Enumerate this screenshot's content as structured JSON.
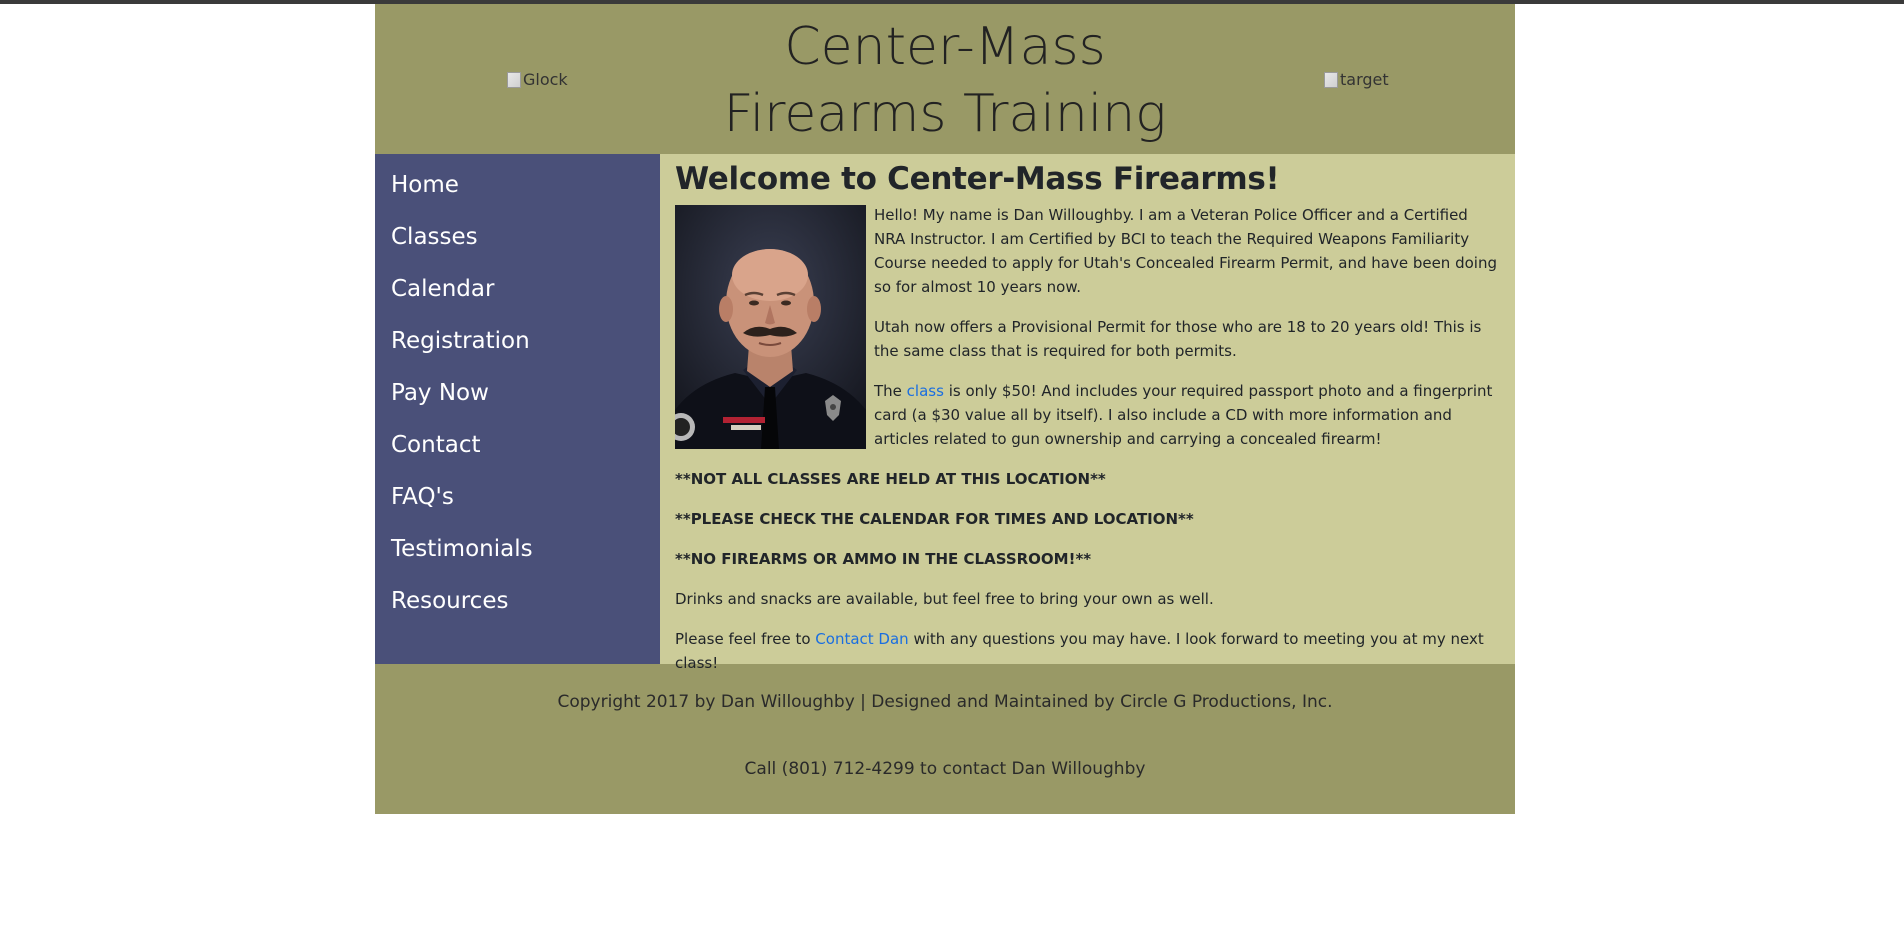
{
  "header": {
    "glock_alt": "Glock",
    "target_alt": "target",
    "title_line1": "Center-Mass",
    "title_line2": "Firearms Training"
  },
  "nav": {
    "items": [
      {
        "label": "Home"
      },
      {
        "label": "Classes"
      },
      {
        "label": "Calendar"
      },
      {
        "label": "Registration"
      },
      {
        "label": "Pay Now"
      },
      {
        "label": "Contact"
      },
      {
        "label": "FAQ's"
      },
      {
        "label": "Testimonials"
      },
      {
        "label": "Resources"
      }
    ]
  },
  "main": {
    "heading": "Welcome to Center-Mass Firearms!",
    "para1": "Hello! My name is Dan Willoughby. I am a Veteran Police Officer and a Certified NRA Instructor. I am Certified by BCI to teach the Required Weapons Familiarity Course needed to apply for Utah's Concealed Firearm Permit, and have been doing so for almost 10 years now.",
    "para2": "Utah now offers a Provisional Permit for those who are 18 to 20 years old! This is the same class that is required for both permits.",
    "para3_start": "The ",
    "para3_link": "class",
    "para3_end": " is only $50! And includes your required passport photo and a fingerprint card (a $30 value all by itself). I also include a CD with more information and articles related to gun ownership and carrying a concealed firearm!",
    "notice1": "**NOT ALL CLASSES ARE HELD AT THIS LOCATION**",
    "notice2": "**PLEASE CHECK THE CALENDAR FOR TIMES AND LOCATION**",
    "notice3": "**NO FIREARMS OR AMMO IN THE CLASSROOM!**",
    "drinks": "Drinks and snacks are available, but feel free to bring your own as well.",
    "contact_start": "Please feel free to ",
    "contact_link": "Contact Dan",
    "contact_end": " with any questions you may have. I look forward to meeting you at my next class!"
  },
  "footer": {
    "copyright": "Copyright 2017 by Dan Willoughby | Designed and Maintained by Circle G Productions, Inc.",
    "call": "Call (801) 712-4299 to contact Dan Willoughby"
  },
  "colors": {
    "header_bg": "#999966",
    "sidebar_bg": "#4a5079",
    "content_bg": "#cccc99",
    "link": "#1a6ee0"
  }
}
